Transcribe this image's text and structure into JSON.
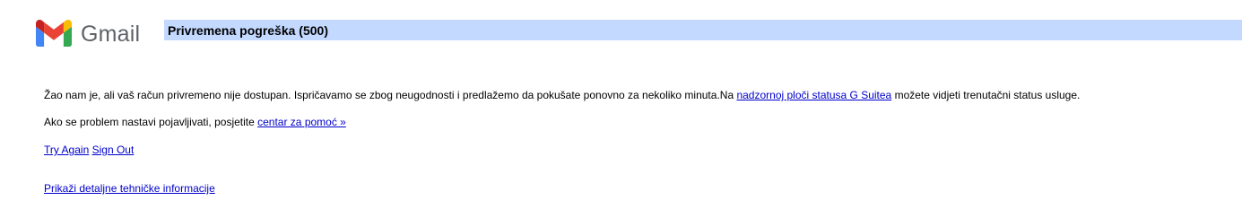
{
  "logo": {
    "wordmark": "Gmail",
    "icon": "gmail-m-logo-icon",
    "colors": {
      "red": "#ea4335",
      "blue": "#4285f4",
      "green": "#34a853",
      "yellow": "#fbbc04",
      "dark_red": "#c5221f"
    }
  },
  "title_bar": {
    "text": "Privremena pogreška (500)",
    "background": "#c3d9ff"
  },
  "message": {
    "line1_text": "Žao nam je, ali vaš račun privremeno nije dostupan. Ispričavamo se zbog neugodnosti i predlažemo da pokušate ponovno za nekoliko minuta.Na ",
    "line1_link": "nadzornoj ploči statusa G Suitea",
    "line1_suffix": " možete vidjeti trenutačni status usluge.",
    "line2_text": "Ako se problem nastavi pojavljivati, posjetite ",
    "line2_link": "centar za pomoć »"
  },
  "actions": {
    "try_again": "Try Again",
    "sign_out": "Sign Out",
    "show_details": "Prikaži detaljne tehničke informacije"
  },
  "link_color": "#0000cc"
}
